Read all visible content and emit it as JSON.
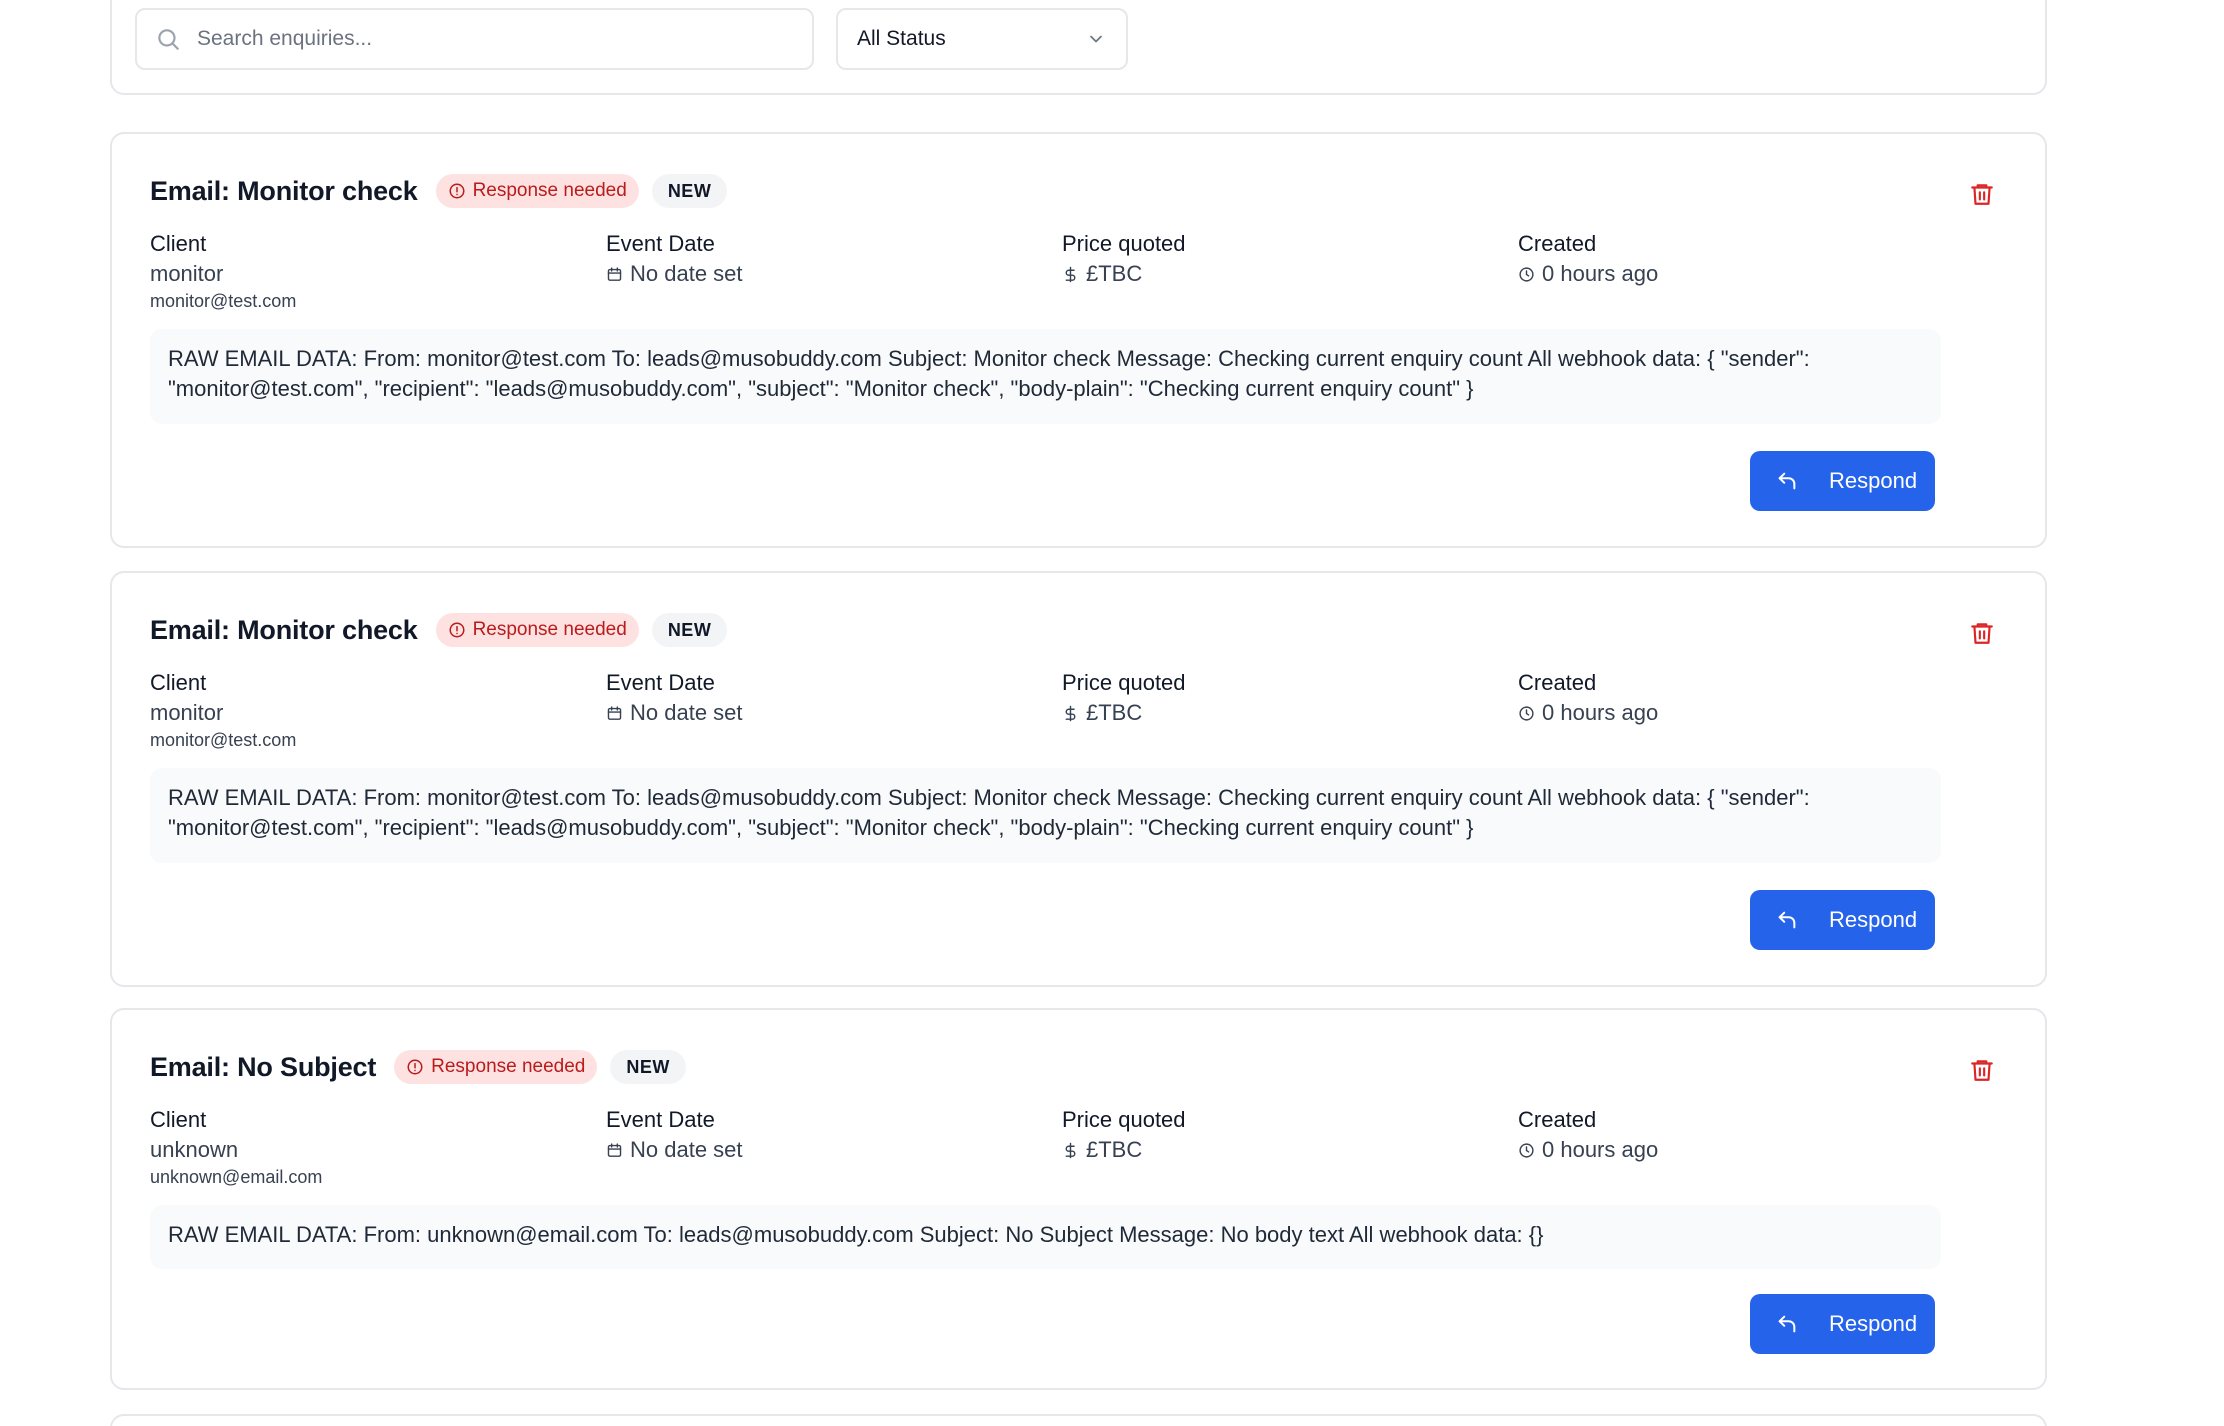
{
  "filters": {
    "search_placeholder": "Search enquiries...",
    "status_value": "All Status"
  },
  "enquiries": [
    {
      "title": "Email: Monitor check",
      "badge_response": "Response needed",
      "badge_status": "NEW",
      "client_label": "Client",
      "client_name": "monitor",
      "client_email": "monitor@test.com",
      "event_label": "Event Date",
      "event_value": "No date set",
      "price_label": "Price quoted",
      "price_value": "£TBC",
      "created_label": "Created",
      "created_value": "0 hours ago",
      "raw_data": "RAW EMAIL DATA: From: monitor@test.com To: leads@musobuddy.com Subject: Monitor check Message: Checking current enquiry count All webhook data: { \"sender\": \"monitor@test.com\", \"recipient\": \"leads@musobuddy.com\", \"subject\": \"Monitor check\", \"body-plain\": \"Checking current enquiry count\" }",
      "respond_label": "Respond"
    },
    {
      "title": "Email: Monitor check",
      "badge_response": "Response needed",
      "badge_status": "NEW",
      "client_label": "Client",
      "client_name": "monitor",
      "client_email": "monitor@test.com",
      "event_label": "Event Date",
      "event_value": "No date set",
      "price_label": "Price quoted",
      "price_value": "£TBC",
      "created_label": "Created",
      "created_value": "0 hours ago",
      "raw_data": "RAW EMAIL DATA: From: monitor@test.com To: leads@musobuddy.com Subject: Monitor check Message: Checking current enquiry count All webhook data: { \"sender\": \"monitor@test.com\", \"recipient\": \"leads@musobuddy.com\", \"subject\": \"Monitor check\", \"body-plain\": \"Checking current enquiry count\" }",
      "respond_label": "Respond"
    },
    {
      "title": "Email: No Subject",
      "badge_response": "Response needed",
      "badge_status": "NEW",
      "client_label": "Client",
      "client_name": "unknown",
      "client_email": "unknown@email.com",
      "event_label": "Event Date",
      "event_value": "No date set",
      "price_label": "Price quoted",
      "price_value": "£TBC",
      "created_label": "Created",
      "created_value": "0 hours ago",
      "raw_data": "RAW EMAIL DATA: From: unknown@email.com To: leads@musobuddy.com Subject: No Subject Message: No body text All webhook data: {}",
      "respond_label": "Respond"
    }
  ],
  "colors": {
    "primary": "#2563eb",
    "danger": "#dc2626",
    "badge_response_bg": "#fee2e2",
    "badge_response_text": "#b91c1c"
  },
  "icons": {
    "search": "search-icon",
    "select": "chevron-down-icon",
    "badge": "alert-circle-icon",
    "delete": "trash-icon",
    "event": "calendar-icon",
    "price": "dollar-icon",
    "created": "clock-icon",
    "respond": "reply-icon"
  }
}
